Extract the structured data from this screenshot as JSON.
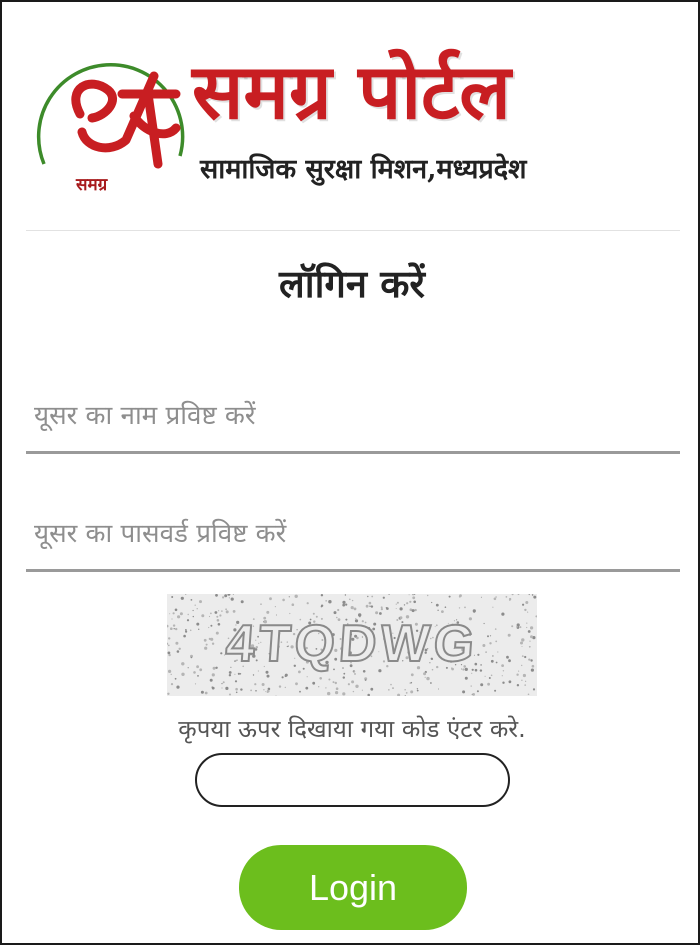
{
  "header": {
    "brand_title": "समग्र पोर्टल",
    "brand_subtitle": "सामाजिक सुरक्षा मिशन,मध्यप्रदेश",
    "emblem_caption": "समग्र"
  },
  "login": {
    "heading": "लॉगिन करें",
    "username_placeholder": "यूसर का नाम प्रविष्ट करें",
    "password_placeholder": "यूसर का पासवर्ड प्रविष्ट करें",
    "captcha_code": "4TQDWG",
    "captcha_hint": "कृपया ऊपर दिखाया गया कोड एंटर करे.",
    "captcha_input_value": "",
    "login_button_label": "Login"
  },
  "colors": {
    "brand_red": "#c81e22",
    "emblem_green": "#3d8b2a",
    "login_green": "#6cbe1d"
  },
  "icons": {
    "logo": "samagra-emblem-icon"
  }
}
